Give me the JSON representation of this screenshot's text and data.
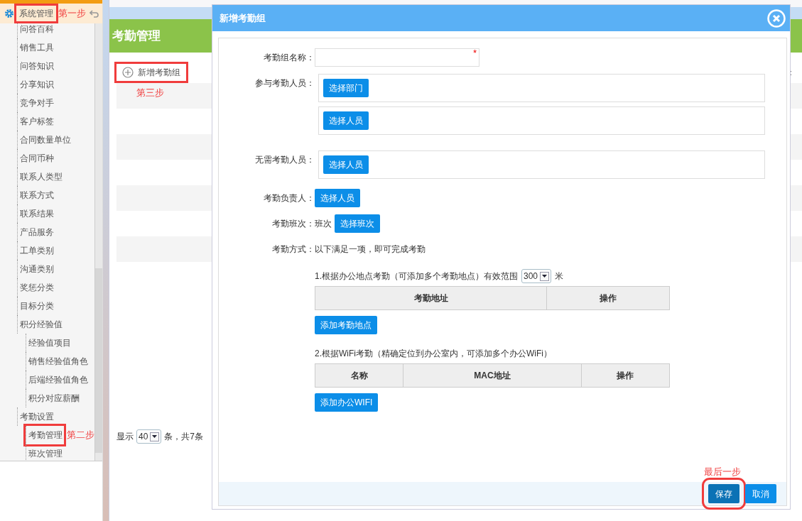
{
  "sidebar": {
    "header": {
      "label": "系统管理",
      "highlighted": true,
      "annotation": "第一步"
    },
    "tree": [
      {
        "children": [
          {
            "label": "问答百科",
            "highlighted": false
          },
          {
            "label": "销售工具",
            "highlighted": false
          },
          {
            "label": "问答知识",
            "highlighted": false
          },
          {
            "label": "分享知识",
            "highlighted": false
          },
          {
            "label": "竞争对手",
            "highlighted": false
          },
          {
            "label": "客户标签",
            "highlighted": false
          },
          {
            "label": "合同数量单位",
            "highlighted": false
          },
          {
            "label": "合同币种",
            "highlighted": false
          },
          {
            "label": "联系人类型",
            "highlighted": false
          },
          {
            "label": "联系方式",
            "highlighted": false
          },
          {
            "label": "联系结果",
            "highlighted": false
          },
          {
            "label": "产品服务",
            "highlighted": false
          },
          {
            "label": "工单类别",
            "highlighted": false
          },
          {
            "label": "沟通类别",
            "highlighted": false
          },
          {
            "label": "奖惩分类",
            "highlighted": false
          },
          {
            "label": "目标分类",
            "highlighted": false
          }
        ]
      },
      {
        "label": "积分经验值",
        "children": [
          {
            "label": "经验值项目",
            "highlighted": false
          },
          {
            "label": "销售经验值角色",
            "highlighted": false
          },
          {
            "label": "后端经验值角色",
            "highlighted": false
          },
          {
            "label": "积分对应薪酬",
            "highlighted": false
          }
        ]
      },
      {
        "label": "考勤设置",
        "children": [
          {
            "label": "考勤管理",
            "highlighted": true,
            "annotation": "第二步"
          },
          {
            "label": "班次管理",
            "highlighted": false
          }
        ]
      }
    ]
  },
  "main": {
    "title": "考勤管理",
    "add_button": {
      "label": "新增考勤组",
      "highlighted": true
    },
    "annotation": "第三步",
    "cut_text": "：",
    "pagination": {
      "prefix": "显示",
      "page_size": "40",
      "suffix": "条，共7条"
    }
  },
  "dialog": {
    "title": "新增考勤组",
    "name_field": {
      "label": "考勤组名称：",
      "required_mark": "*"
    },
    "participants": {
      "label": "参与考勤人员：",
      "buttons": [
        "选择部门",
        "选择人员"
      ]
    },
    "exempt": {
      "label": "无需考勤人员：",
      "buttons": [
        "选择人员"
      ]
    },
    "manager": {
      "label": "考勤负责人：",
      "button": "选择人员"
    },
    "shift": {
      "label": "考勤班次：",
      "value": "班次",
      "button": "选择班次"
    },
    "method": {
      "label": "考勤方式：",
      "value": "以下满足一项，即可完成考勤"
    },
    "location": {
      "text": "1.根据办公地点考勤（可添加多个考勤地点）有效范围",
      "range": "300",
      "unit": "米",
      "columns": [
        "考勤地址",
        "操作"
      ],
      "add_button": "添加考勤地点"
    },
    "wifi": {
      "text": "2.根据WiFi考勤（精确定位到办公室内，可添加多个办公WiFi）",
      "columns": [
        "名称",
        "MAC地址",
        "操作"
      ],
      "add_button": "添加办公WIFI"
    },
    "annotation": "最后一步",
    "footer_buttons": [
      {
        "label": "保存",
        "kind": "primary",
        "highlighted": true
      },
      {
        "label": "取消",
        "kind": "secondary",
        "highlighted": false
      }
    ]
  }
}
